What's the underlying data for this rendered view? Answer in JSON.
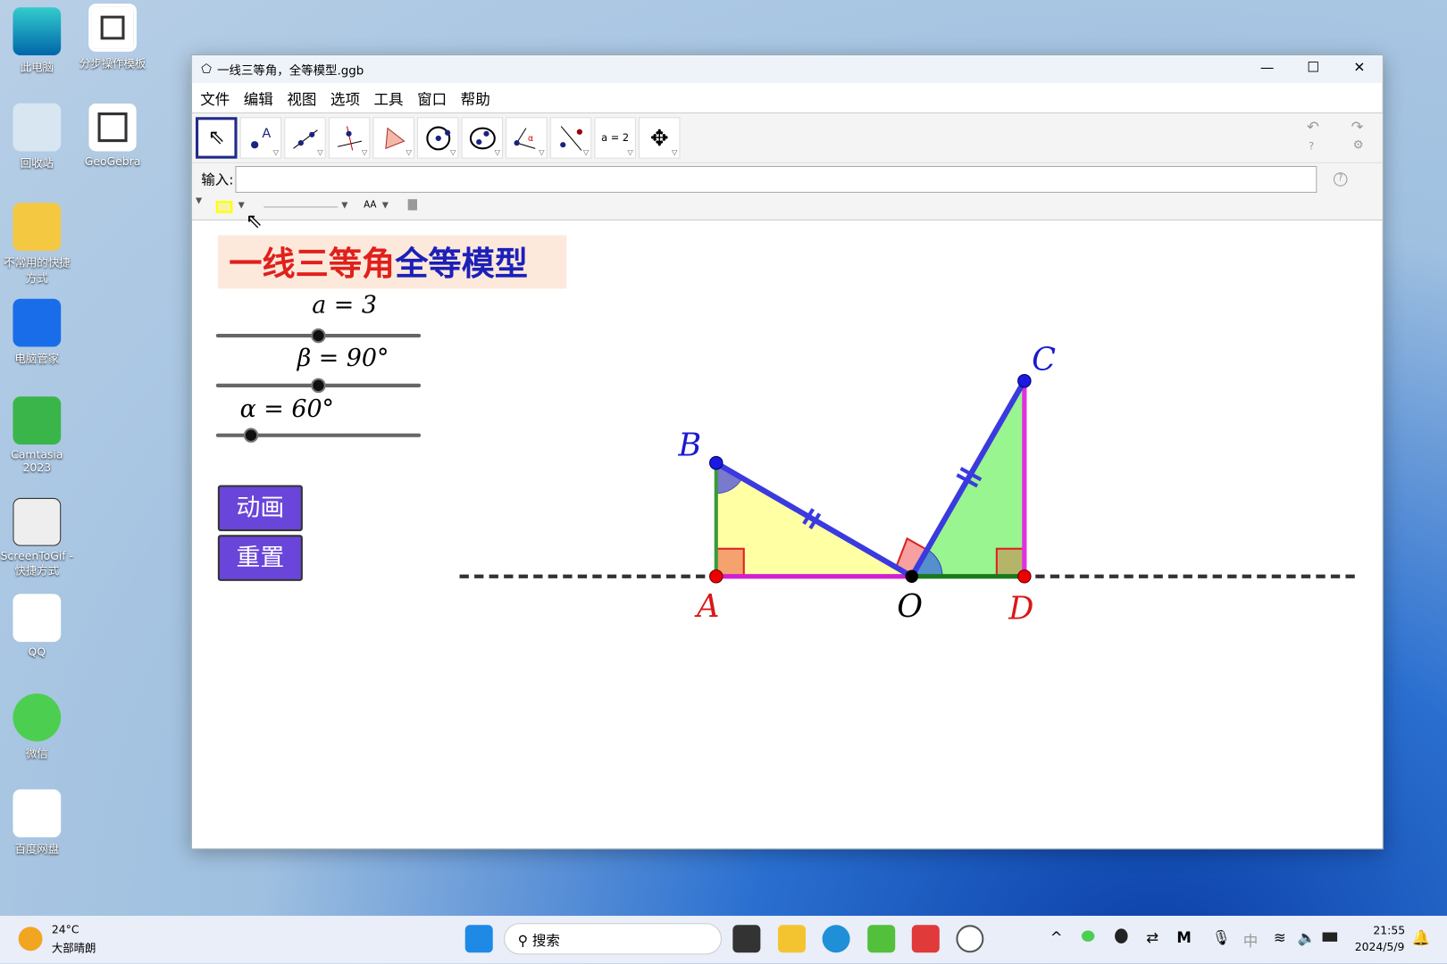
{
  "desktop": [
    {
      "label": "此电脑",
      "icon": "computer-icon"
    },
    {
      "label": "分步操作模板",
      "icon": "geogebra-icon"
    },
    {
      "label": "回收站",
      "icon": "recycle-bin-icon"
    },
    {
      "label": "GeoGebra",
      "icon": "geogebra-icon"
    },
    {
      "label": "不常用的快捷方式",
      "icon": "folder-icon"
    },
    {
      "label": "电脑管家",
      "icon": "shield-icon"
    },
    {
      "label": "Camtasia 2023",
      "icon": "camtasia-icon"
    },
    {
      "label": "ScreenToGif - 快捷方式",
      "icon": "screentogif-icon"
    },
    {
      "label": "QQ",
      "icon": "qq-icon"
    },
    {
      "label": "微信",
      "icon": "wechat-icon"
    },
    {
      "label": "百度网盘",
      "icon": "baidu-netdisk-icon"
    }
  ],
  "window": {
    "title": "一线三等角，全等模型.ggb",
    "menu": [
      "文件",
      "编辑",
      "视图",
      "选项",
      "工具",
      "窗口",
      "帮助"
    ],
    "input_label": "输入:",
    "input_value": "",
    "tool_text": "a = 2",
    "font_btn": "AA"
  },
  "canvas": {
    "title_red": "一线三等角",
    "title_blue": "全等模型",
    "sliders": [
      {
        "label": "a = 3",
        "value": 3,
        "fraction": 0.5
      },
      {
        "label": "β = 90°",
        "value": 90,
        "fraction": 0.5
      },
      {
        "label": "α = 60°",
        "value": 60,
        "fraction": 0.18
      }
    ],
    "buttons": [
      "动画",
      "重置"
    ],
    "points": {
      "A": "A",
      "B": "B",
      "C": "C",
      "D": "D",
      "O": "O"
    }
  },
  "taskbar": {
    "temp": "24°C",
    "weather": "大部晴朗",
    "search": "搜索",
    "time": "21:55",
    "date": "2024/5/9",
    "ime": "中"
  }
}
